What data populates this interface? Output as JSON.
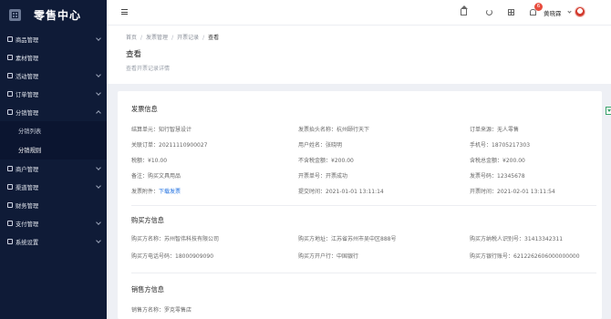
{
  "app": {
    "title": "零售中心"
  },
  "sidebar": {
    "items": [
      {
        "label": "商品管理"
      },
      {
        "label": "素材管理"
      },
      {
        "label": "活动管理"
      },
      {
        "label": "订单管理"
      },
      {
        "label": "分销管理"
      },
      {
        "label": "分销列表"
      },
      {
        "label": "分销规则"
      },
      {
        "label": "商户管理"
      },
      {
        "label": "渠道管理"
      },
      {
        "label": "财务管理"
      },
      {
        "label": "支付管理"
      },
      {
        "label": "系统设置"
      }
    ]
  },
  "topbar": {
    "badge_count": "6",
    "user_name": "黄晓霖"
  },
  "breadcrumb": {
    "items": [
      "首页",
      "发票管理",
      "开票记录",
      "查看"
    ]
  },
  "page": {
    "title": "查看",
    "description": "查看开票记录详情"
  },
  "invoice": {
    "section_title": "发票信息",
    "rows": [
      [
        [
          "结算单元：",
          "知行智慧设计"
        ],
        [
          "发票抬头名称：",
          "杭州颐行天下"
        ],
        [
          "订单来源：",
          "无人零售"
        ]
      ],
      [
        [
          "关联订单：",
          "20211110900027"
        ],
        [
          "用户姓名：",
          "张晓明"
        ],
        [
          "手机号：",
          "18705217303"
        ]
      ],
      [
        [
          "税额：",
          "¥10.00"
        ],
        [
          "不含税金额：",
          "¥200.00"
        ],
        [
          "含税总金额：",
          "¥200.00"
        ]
      ],
      [
        [
          "备注：",
          "购买文具用品"
        ],
        [
          "开票单号：",
          "开票成功"
        ],
        [
          "发票号码：",
          "12345678"
        ]
      ],
      [
        [
          "发票附件：",
          "下载发票"
        ],
        [
          "提交时间：",
          "2021-01-01 13:11:14"
        ],
        [
          "开票时间：",
          "2021-02-01 13:11:54"
        ]
      ]
    ]
  },
  "buyer": {
    "section_title": "购买方信息",
    "rows": [
      [
        [
          "购买方名称：",
          "苏州智伟科技有限公司"
        ],
        [
          "购买方地址：",
          "江苏省苏州市吴中区888号"
        ],
        [
          "购买方纳税人识别号：",
          "31413342311"
        ]
      ],
      [
        [
          "购买方电话号码：",
          "18000909090"
        ],
        [
          "购买方开户行：",
          "中国银行"
        ],
        [
          "购买方银行账号：",
          "6212262606000000000"
        ]
      ]
    ]
  },
  "seller": {
    "section_title": "销售方信息",
    "rows": [
      [
        [
          "销售方名称：",
          "罗克零售店"
        ]
      ]
    ]
  }
}
